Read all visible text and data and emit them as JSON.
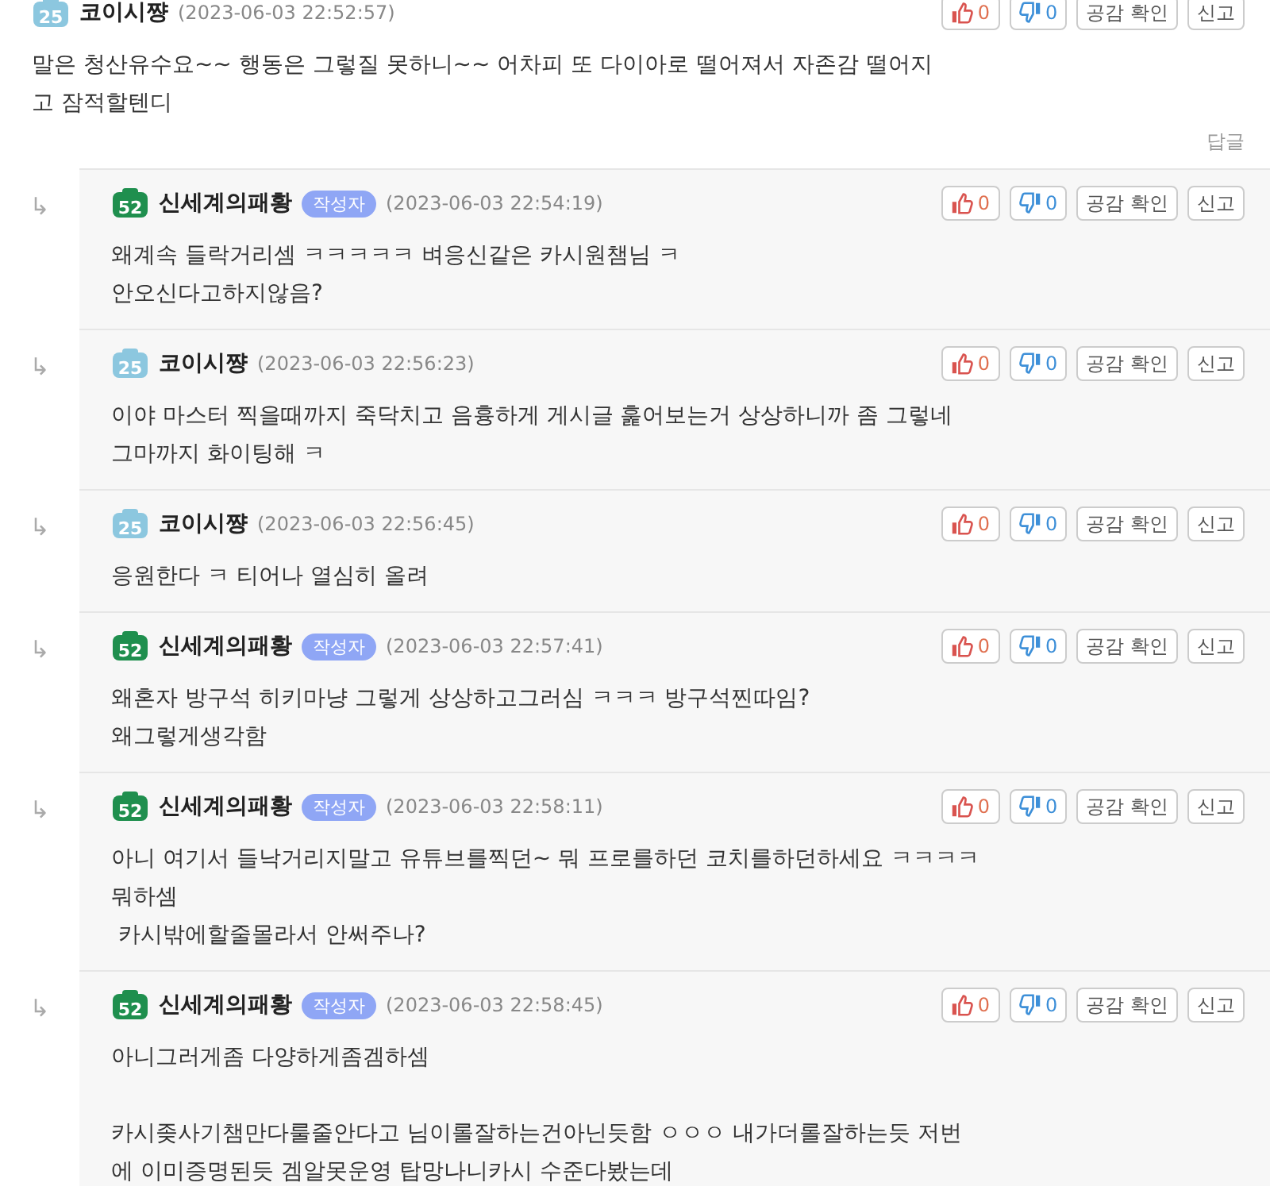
{
  "comments": [
    {
      "reply": false,
      "level": "25",
      "author": "코이시쨩",
      "is_writer": false,
      "time": "(2023-06-03 22:52:57)",
      "likes": "0",
      "dislikes": "0",
      "empathy_label": "공감 확인",
      "report_label": "신고",
      "paragraphs": [
        [
          "말은 청산유수요~~ 행동은 그렇질 못하니~~ 어차피 또 다이아로 떨어져서 자존감 떨어지",
          "고 잠적할텐디"
        ]
      ],
      "reply_link": "답글"
    },
    {
      "reply": true,
      "arrow": "↳",
      "level": "52",
      "author": "신세계의패황",
      "is_writer": true,
      "writer_badge": "작성자",
      "time": "(2023-06-03 22:54:19)",
      "likes": "0",
      "dislikes": "0",
      "empathy_label": "공감 확인",
      "report_label": "신고",
      "paragraphs": [
        [
          "왜계속 들락거리셈 ㅋㅋㅋㅋㅋ 벼응신같은 카시원챔님 ㅋ",
          "안오신다고하지않음?"
        ]
      ]
    },
    {
      "reply": true,
      "arrow": "↳",
      "level": "25",
      "author": "코이시쨩",
      "is_writer": false,
      "time": "(2023-06-03 22:56:23)",
      "likes": "0",
      "dislikes": "0",
      "empathy_label": "공감 확인",
      "report_label": "신고",
      "paragraphs": [
        [
          "이야 마스터 찍을때까지 죽닥치고 음흉하게 게시글 훑어보는거 상상하니까 좀 그렇네",
          "그마까지 화이팅해 ㅋ"
        ]
      ]
    },
    {
      "reply": true,
      "arrow": "↳",
      "level": "25",
      "author": "코이시쨩",
      "is_writer": false,
      "time": "(2023-06-03 22:56:45)",
      "likes": "0",
      "dislikes": "0",
      "empathy_label": "공감 확인",
      "report_label": "신고",
      "paragraphs": [
        [
          "응원한다 ㅋ 티어나 열심히 올려"
        ]
      ]
    },
    {
      "reply": true,
      "arrow": "↳",
      "level": "52",
      "author": "신세계의패황",
      "is_writer": true,
      "writer_badge": "작성자",
      "time": "(2023-06-03 22:57:41)",
      "likes": "0",
      "dislikes": "0",
      "empathy_label": "공감 확인",
      "report_label": "신고",
      "paragraphs": [
        [
          "왜혼자 방구석 히키마냥 그렇게 상상하고그러심 ㅋㅋㅋ 방구석찐따임?",
          "왜그렇게생각함"
        ]
      ]
    },
    {
      "reply": true,
      "arrow": "↳",
      "level": "52",
      "author": "신세계의패황",
      "is_writer": true,
      "writer_badge": "작성자",
      "time": "(2023-06-03 22:58:11)",
      "likes": "0",
      "dislikes": "0",
      "empathy_label": "공감 확인",
      "report_label": "신고",
      "paragraphs": [
        [
          "아니 여기서 들낙거리지말고 유튜브를찍던~ 뭐 프로를하던 코치를하던하세요 ㅋㅋㅋㅋ",
          "뭐하셈",
          " 카시밖에할줄몰라서 안써주나?"
        ]
      ]
    },
    {
      "reply": true,
      "arrow": "↳",
      "level": "52",
      "author": "신세계의패황",
      "is_writer": true,
      "writer_badge": "작성자",
      "time": "(2023-06-03 22:58:45)",
      "likes": "0",
      "dislikes": "0",
      "empathy_label": "공감 확인",
      "report_label": "신고",
      "paragraphs": [
        [
          "아니그러게좀 다양하게좀겜하셈"
        ],
        [
          "카시좆사기챔만다룰줄안다고 님이롤잘하는건아닌듯함 ㅇㅇㅇ 내가더롤잘하는듯 저번",
          "에 이미증명된듯 겜알못운영 탑망나니카시 수준다봤는데"
        ]
      ]
    }
  ]
}
